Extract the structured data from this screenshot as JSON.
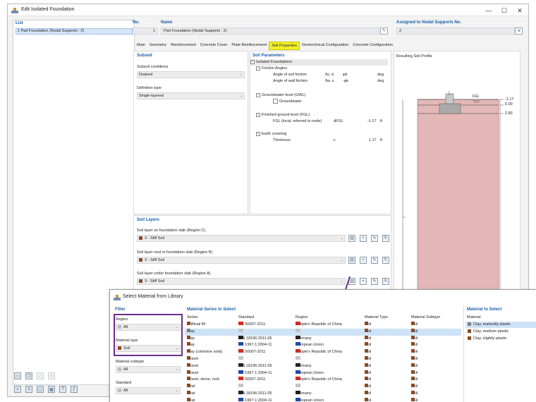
{
  "window": {
    "title": "Edit Isolated Foundation"
  },
  "list": {
    "header": "List",
    "items": [
      "1  Pad Foundation (Nodal Supports : 2)"
    ]
  },
  "header_fields": {
    "no_label": "No.",
    "no_value": "1",
    "name_label": "Name",
    "name_value": "Pad Foundation (Nodal Supports : 2)",
    "assigned_label": "Assigned to Nodal Supports No.",
    "assigned_value": "2"
  },
  "tabs": [
    "Main",
    "Geometry",
    "Reinforcement",
    "Concrete Cover",
    "Plate Reinforcement",
    "Soil Properties",
    "Geotechnical Configuration",
    "Concrete Configuration"
  ],
  "active_tab_index": 5,
  "subsoil": {
    "title": "Subsoil",
    "conditions_label": "Subsoil conditions",
    "conditions_value": "Drained",
    "definition_label": "Definition type",
    "definition_value": "Single-layered"
  },
  "soil_parameters": {
    "title": "Soil Parameters",
    "root": "Isolated Foundations",
    "friction_group": "Friction Angles",
    "soil_friction_label": "Angle of soil friction",
    "soil_friction_sym": "δs, d",
    "soil_friction_val": "φk",
    "soil_friction_unit": "deg",
    "wall_friction_label": "Angle of wall friction",
    "wall_friction_sym": "δw, s",
    "wall_friction_val": "-φk",
    "wall_friction_unit": "deg",
    "gwl_group": "Groundwater level (GWL)",
    "groundwater_label": "Groundwater",
    "fgl_group": "Finished ground level (FGL)",
    "fgl_label": "FGL (local, referred to node)",
    "fgl_sym": "dFGL",
    "fgl_val": "-1.17",
    "fgl_unit": "ft",
    "earth_group": "Earth covering",
    "thickness_label": "Thickness",
    "thickness_sym": "c",
    "thickness_val": "1.17",
    "thickness_unit": "ft"
  },
  "profile": {
    "title": "Resulting Soil Profile",
    "fgl_tag": "FGL",
    "level_1": "-1.17",
    "level_2": "0.00",
    "level_3": "2.83"
  },
  "soil_layers": {
    "title": "Soil Layers",
    "region_c_label": "Soil layer on foundation slab (Region C)",
    "region_c_value": "3 - Stiff Soil",
    "region_b_label": "Soil layer next to foundation slab (Region B)",
    "region_b_value": "3 - Stiff Soil",
    "region_a_label": "Soil layer under foundation slab (Region A)",
    "region_a_value": "3 - Stiff Soil"
  },
  "library": {
    "title": "Select Material from Library",
    "filter_title": "Filter",
    "region_label": "Region",
    "region_value": "All",
    "type_label": "Material type",
    "type_value": "Soil",
    "subtype_label": "Material subtype",
    "subtype_value": "All",
    "standard_label": "Standard",
    "standard_value": "All",
    "series_title": "Material Series to Select",
    "columns": [
      "Series",
      "Standard",
      "Region",
      "Material Type",
      "Material Subtype"
    ],
    "rows": [
      [
        "Artificial fill",
        "GB 50007-2011",
        "People's Republic of China",
        "Soil",
        "Soil"
      ],
      [
        "Clay",
        "--",
        "--",
        "Soil",
        "Soil"
      ],
      [
        "Clay",
        "DIN 18196:2011-05",
        "Germany",
        "Soil",
        "Soil"
      ],
      [
        "Clay",
        "EN 1997-1:2004-11",
        "European Union",
        "Soil",
        "Soil"
      ],
      [
        "Clay (cohesive soils)",
        "GB 50007-2011",
        "People's Republic of China",
        "Soil",
        "Soil"
      ],
      [
        "Gravel",
        "--",
        "--",
        "Soil",
        "Soil"
      ],
      [
        "Gravel",
        "DIN 18196:2011-05",
        "Germany",
        "Soil",
        "Soil"
      ],
      [
        "Gravel",
        "EN 1997-1:2004-11",
        "European Union",
        "Soil",
        "Soil"
      ],
      [
        "Gravel, stone, rock",
        "GB 50007-2011",
        "People's Republic of China",
        "Soil",
        "Soil"
      ],
      [
        "Peat",
        "--",
        "--",
        "Soil",
        "Soil"
      ],
      [
        "Peat",
        "DIN 18196:2011-05",
        "Germany",
        "Soil",
        "Soil"
      ],
      [
        "Peat",
        "EN 1997-1:2004-11",
        "European Union",
        "Soil",
        "Soil"
      ]
    ],
    "selected_row_index": 1,
    "material_title": "Material to Select",
    "material_col": "Material",
    "materials": [
      "Clay, markedly plastic",
      "Clay, medium plastic",
      "Clay, slightly plastic"
    ],
    "selected_material_index": 0
  },
  "colors": {
    "accent": "#1b5ea6",
    "soil_brown": "#8b4a25",
    "soil_gray": "#7d7d7d",
    "soil_profile": "#e3b8b6",
    "highlight_tab": "#f3f02a",
    "filter_border": "#6b2d8f",
    "selection": "#cfe3f7"
  }
}
